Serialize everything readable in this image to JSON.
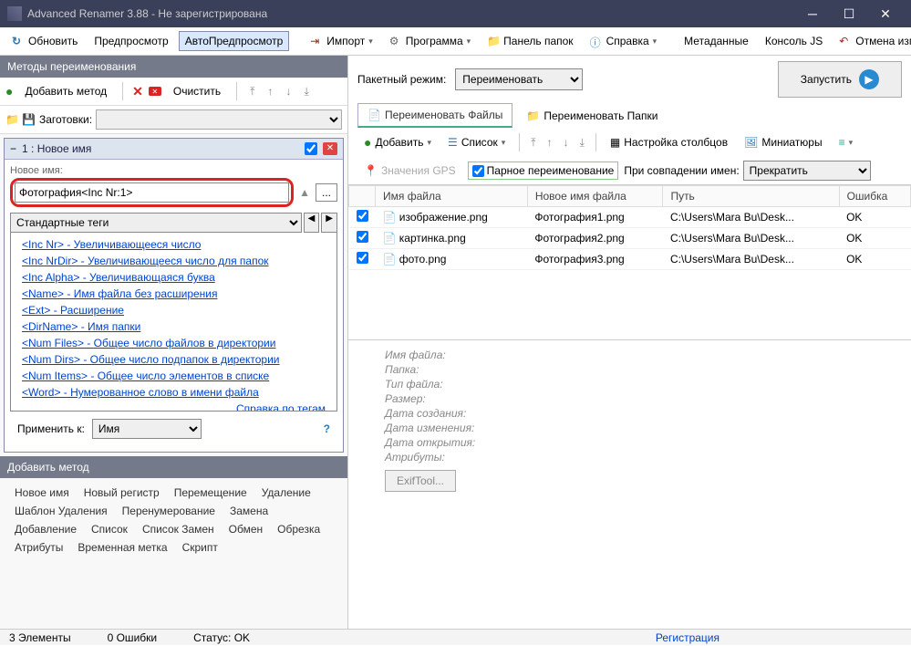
{
  "title": "Advanced Renamer 3.88 - Не зарегистрирована",
  "toolbar": {
    "refresh": "Обновить",
    "preview": "Предпросмотр",
    "autopreview": "АвтоПредпросмотр",
    "import": "Импорт",
    "program": "Программа",
    "folderpanel": "Панель папок",
    "help": "Справка",
    "metadata": "Метаданные",
    "consolejs": "Консоль JS",
    "undo": "Отмена изменений..."
  },
  "left": {
    "methods_header": "Методы переименования",
    "add_method": "Добавить метод",
    "clear": "Очистить",
    "presets_label": "Заготовки:",
    "method1": {
      "title": "1 : Новое имя",
      "new_name_label": "Новое имя:",
      "value": "Фотография<Inc Nr:1>",
      "dots": "...",
      "tags_header": "Стандартные теги",
      "tags": [
        "<Inc Nr> - Увеличивающееся число",
        "<Inc NrDir> - Увеличивающееся число для папок",
        "<Inc Alpha> - Увеличивающаяся буква",
        "<Name> - Имя файла без расширения",
        "<Ext> - Расширение",
        "<DirName> - Имя папки",
        "<Num Files> - Общее число файлов в директории",
        "<Num Dirs> - Общее число подпапок в директории",
        "<Num Items> - Общее число элементов в списке",
        "<Word> - Нумерованное слово в имени файла"
      ],
      "tags_help": "Справка по тегам",
      "apply_to": "Применить к:",
      "apply_value": "Имя"
    },
    "add_header": "Добавить метод",
    "method_types": [
      "Новое имя",
      "Новый регистр",
      "Перемещение",
      "Удаление",
      "Шаблон Удаления",
      "Перенумерование",
      "Замена",
      "Добавление",
      "Список",
      "Список Замен",
      "Обмен",
      "Обрезка",
      "Атрибуты",
      "Временная метка",
      "Скрипт"
    ]
  },
  "right": {
    "batch_mode": "Пакетный режим:",
    "batch_value": "Переименовать",
    "run": "Запустить",
    "tab_files": "Переименовать Файлы",
    "tab_folders": "Переименовать Папки",
    "add": "Добавить",
    "list": "Список",
    "columns": "Настройка столбцов",
    "thumbs": "Миниатюры",
    "gps": "Значения GPS",
    "pair": "Парное переименование",
    "match_label": "При совпадении имен:",
    "match_value": "Прекратить",
    "cols": {
      "name": "Имя файла",
      "newname": "Новое имя файла",
      "path": "Путь",
      "error": "Ошибка"
    },
    "rows": [
      {
        "name": "изображение.png",
        "newname": "Фотография1.png",
        "path": "C:\\Users\\Mara Bu\\Desk...",
        "error": "OK"
      },
      {
        "name": "картинка.png",
        "newname": "Фотография2.png",
        "path": "C:\\Users\\Mara Bu\\Desk...",
        "error": "OK"
      },
      {
        "name": "фото.png",
        "newname": "Фотография3.png",
        "path": "C:\\Users\\Mara Bu\\Desk...",
        "error": "OK"
      }
    ],
    "info": {
      "filename": "Имя файла:",
      "folder": "Папка:",
      "filetype": "Тип файла:",
      "size": "Размер:",
      "created": "Дата создания:",
      "modified": "Дата изменения:",
      "opened": "Дата открытия:",
      "attrs": "Атрибуты:"
    },
    "exif": "ExifTool..."
  },
  "status": {
    "elements": "3 Элементы",
    "errors": "0 Ошибки",
    "status": "Статус: OK",
    "reg": "Регистрация"
  }
}
